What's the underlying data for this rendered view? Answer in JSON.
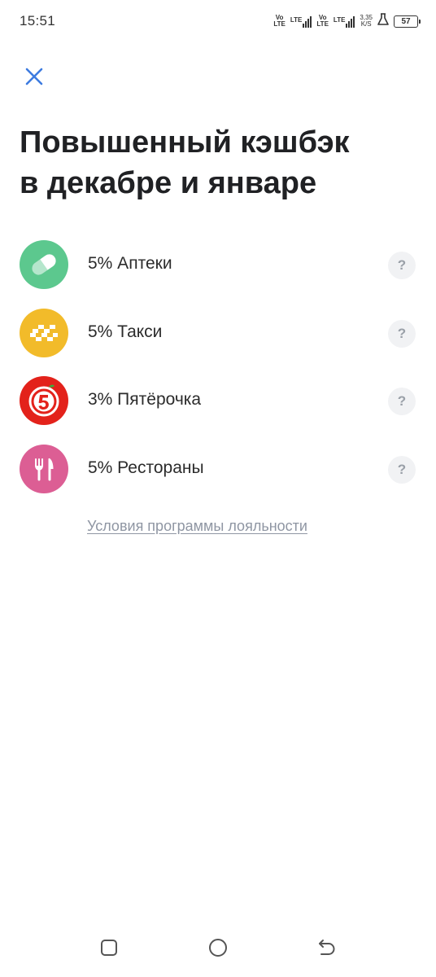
{
  "status_bar": {
    "time": "15:51",
    "sim1_volte": [
      "Vo",
      "LTE"
    ],
    "sim1_lte": "LTE",
    "sim2_volte": [
      "Vo",
      "LTE"
    ],
    "sim2_lte": "LTE",
    "net_speed": [
      "3,35",
      "K/S"
    ],
    "battery_level": "57"
  },
  "header": {
    "close_icon": "close-icon",
    "title_line1": "Повышенный кэшбэк",
    "title_line2": "в декабре и январе"
  },
  "cashback_items": [
    {
      "label": "5% Аптеки",
      "icon": "pill-icon",
      "color": "#5cc88e"
    },
    {
      "label": "5% Такси",
      "icon": "taxi-checker-icon",
      "color": "#f2bb2a"
    },
    {
      "label": "3% Пятёрочка",
      "icon": "pyaterochka-logo-icon",
      "color": "#e3221b"
    },
    {
      "label": "5% Рестораны",
      "icon": "fork-knife-icon",
      "color": "#dc5e94"
    }
  ],
  "help_label": "?",
  "loyalty_link": "Условия программы лояльности",
  "nav_bar": {
    "recent": "recent-apps-icon",
    "home": "home-icon",
    "back": "back-icon"
  },
  "colors": {
    "accent": "#3d7be0",
    "title": "#202124",
    "link": "#8f96a3"
  }
}
